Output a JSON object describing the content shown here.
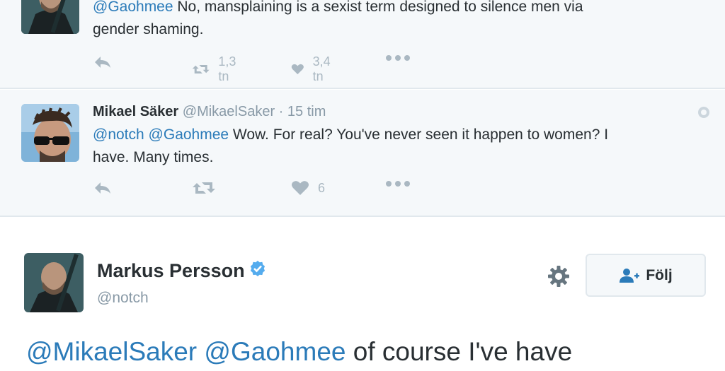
{
  "reply_1": {
    "text_mention": "@Gaohmee",
    "text_line1": " No, mansplaining is a sexist term designed to silence men via",
    "text_line2": "gender shaming.",
    "retweet_count": "1,3 tn",
    "like_count": "3,4 tn",
    "icons": {
      "reply": "reply-icon",
      "retweet": "retweet-icon",
      "like": "heart-icon",
      "more": "more-dots-icon"
    }
  },
  "reply_2": {
    "fullname": "Mikael Säker",
    "handle": "@MikaelSaker",
    "separator": "·",
    "time": "15 tim",
    "mention_1": "@notch",
    "mention_2": "@Gaohmee",
    "text_line1": " Wow. For real? You've never seen it happen to women? I",
    "text_line2": "have. Many times.",
    "like_count": "6"
  },
  "main_tweet": {
    "fullname": "Markus Persson",
    "handle": "@notch",
    "follow_label": "Följ",
    "mention_1": "@MikaelSaker",
    "mention_2": "@Gaohmee",
    "text": " of course I've have"
  },
  "colors": {
    "link": "#2b7bb9",
    "muted": "#8899a6",
    "text": "#292f33",
    "reply_background": "#f5f8fa",
    "verified": "#55acee"
  }
}
